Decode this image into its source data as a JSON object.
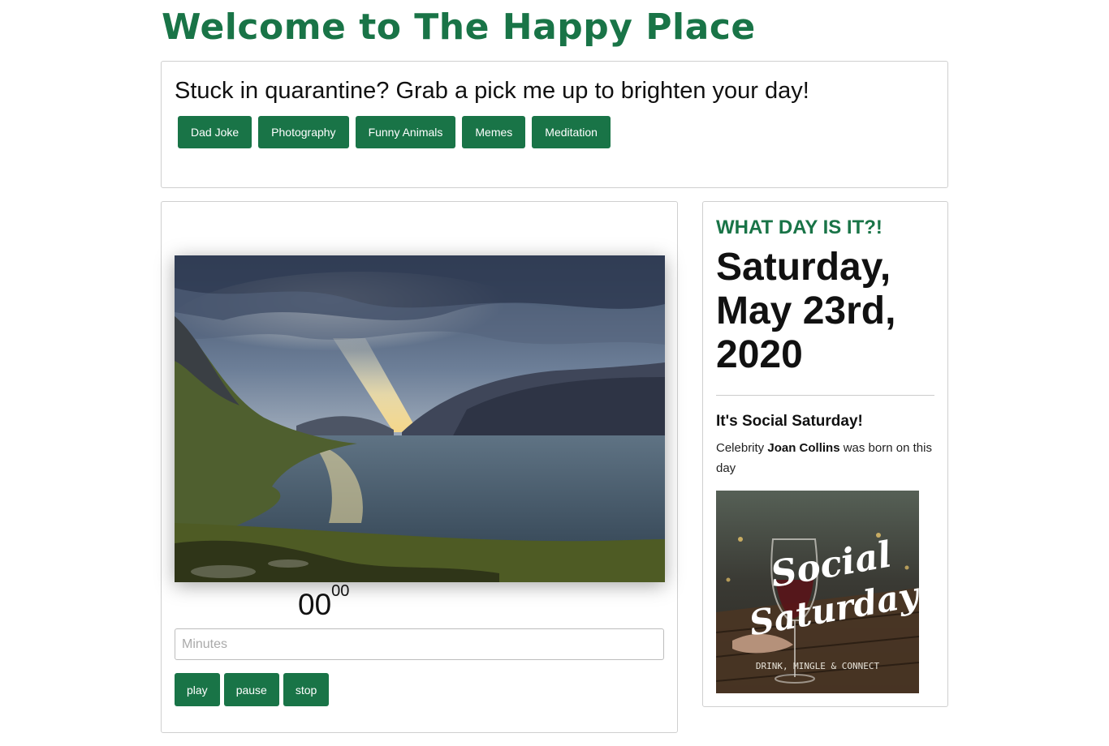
{
  "header": {
    "title": "Welcome to The Happy Place"
  },
  "pickme": {
    "heading": "Stuck in quarantine? Grab a pick me up to brighten your day!",
    "buttons": [
      "Dad Joke",
      "Photography",
      "Funny Animals",
      "Memes",
      "Meditation"
    ]
  },
  "player": {
    "timer_main": "00",
    "timer_sup": "00",
    "minutes_placeholder": "Minutes",
    "controls": {
      "play": "play",
      "pause": "pause",
      "stop": "stop"
    }
  },
  "day": {
    "eyebrow": "WHAT DAY IS IT?!",
    "date": "Saturday, May 23rd, 2020",
    "theme": "It's Social Saturday!",
    "fact_prefix": "Celebrity ",
    "fact_name": "Joan Collins",
    "fact_suffix": " was born on this day",
    "image": {
      "script_line1": "Social",
      "script_line2": "Saturday",
      "tagline": "DRINK, MINGLE & CONNECT"
    }
  },
  "colors": {
    "accent": "#197447",
    "border": "#cfcfcf"
  }
}
